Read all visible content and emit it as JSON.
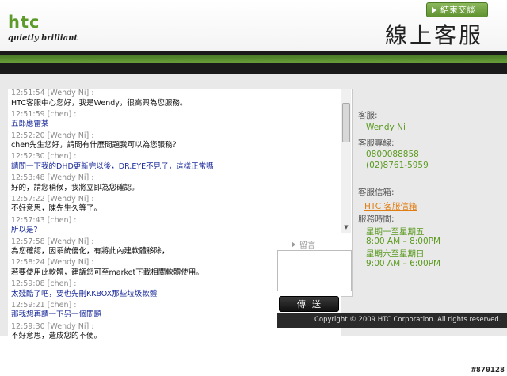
{
  "header": {
    "logo_text": "htc",
    "logo_tagline": "quietly brilliant",
    "end_button_label": "結束交談",
    "title": "線上客服"
  },
  "chat": {
    "messages": [
      {
        "meta": "12:51:54 [Wendy Ni] :",
        "text": "HTC客服中心您好，我是Wendy，很高興為您服務。",
        "role": "agent"
      },
      {
        "meta": "12:51:59 [chen] :",
        "text": "五郎應雷某",
        "role": "user"
      },
      {
        "meta": "12:52:20 [Wendy Ni] :",
        "text": "chen先生您好，請問有什麼問題我可以為您服務？",
        "role": "agent"
      },
      {
        "meta": "12:52:30 [chen] :",
        "text": "請問一下我的DHD更新完以後，DR.EYE不見了，這樣正常嗎",
        "role": "user"
      },
      {
        "meta": "12:53:48 [Wendy Ni] :",
        "text": "好的，請您稍候，我將立即為您確認。",
        "role": "agent"
      },
      {
        "meta": "12:57:22 [Wendy Ni] :",
        "text": "不好意思，陳先生久等了。",
        "role": "agent"
      },
      {
        "meta": "12:57:43 [chen] :",
        "text": "所以是?",
        "role": "user"
      },
      {
        "meta": "12:57:58 [Wendy Ni] :",
        "text": "為您確認，因系統優化，有將此內建軟體移除，",
        "role": "agent"
      },
      {
        "meta": "12:58:24 [Wendy Ni] :",
        "text": "若要使用此軟體，建議您可至market下載相關軟體使用。",
        "role": "agent"
      },
      {
        "meta": "12:59:08 [chen] :",
        "text": "太殘酷了吧，要也先刪KKBOX那些垃圾軟體",
        "role": "user"
      },
      {
        "meta": "12:59:21 [chen] :",
        "text": "那我想再請一下另一個問題",
        "role": "user"
      },
      {
        "meta": "12:59:30 [Wendy Ni] :",
        "text": "不好意思，造成您的不便。",
        "role": "agent"
      }
    ]
  },
  "message_box": {
    "label": "留言",
    "input_value": "",
    "send_label": "傳送"
  },
  "info": {
    "agent_label": "客服:",
    "agent_name": "Wendy Ni",
    "hotline_label": "客服專線:",
    "hotline_1": "0800088858",
    "hotline_2": "(02)8761-5959",
    "mailbox_label": "客服信箱:",
    "mailbox_link": "HTC 客服信箱",
    "hours_label": "服務時間:",
    "hours_weekday_days": "星期一至星期五",
    "hours_weekday_time": "8:00 AM – 8:00PM",
    "hours_weekend_days": "星期六至星期日",
    "hours_weekend_time": "9:00 AM – 6:00PM"
  },
  "footer": {
    "copyright": "Copyright © 2009 HTC Corporation. All rights reserved.",
    "image_id": "#870128"
  },
  "colors": {
    "brand_green": "#5c9a2a",
    "link_orange": "#e07d13",
    "user_text": "#1a2a9a"
  }
}
